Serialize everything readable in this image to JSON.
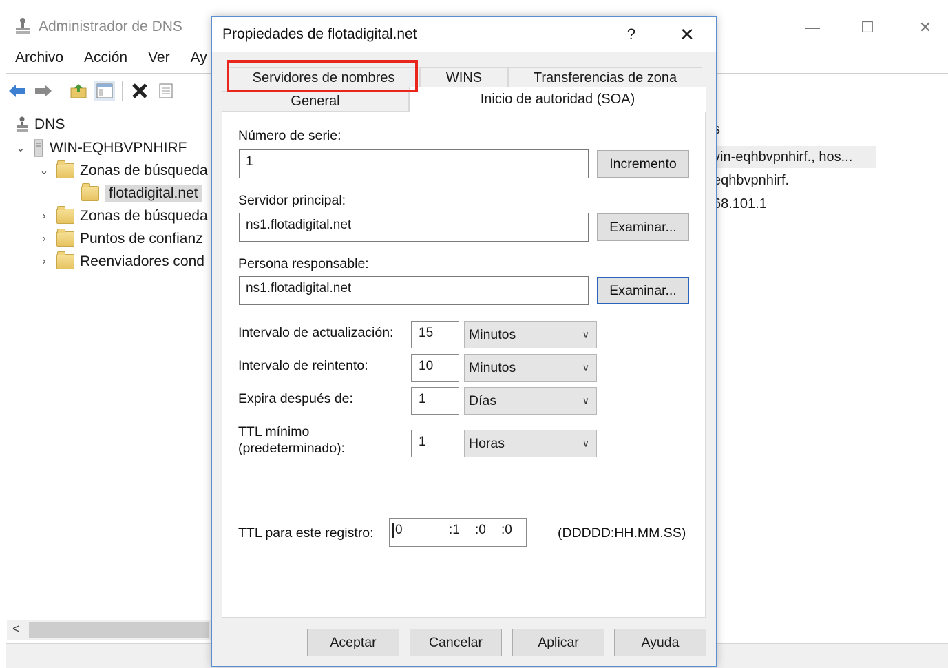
{
  "background_window": {
    "title": "Administrador de DNS",
    "menu": [
      "Archivo",
      "Acción",
      "Ver",
      "Ay"
    ],
    "controls": {
      "minimize": "—",
      "maximize": "☐",
      "close": "✕"
    },
    "tree": {
      "root": "DNS",
      "server": "WIN-EQHBVPNHIRF",
      "forward_zones": "Zonas de búsqueda",
      "zone": "flotadigital.net",
      "reverse_zones": "Zonas de búsqueda",
      "trust_points": "Puntos de confianz",
      "forwarders": "Reenviadores cond"
    },
    "right_pane": {
      "header": "s",
      "rows": [
        "vin-eqhbvpnhirf., hos...",
        "eqhbvpnhirf.",
        "68.101.1"
      ]
    },
    "scroll_left": "<"
  },
  "dialog": {
    "title": "Propiedades de flotadigital.net",
    "help": "?",
    "close": "✕",
    "tabs": {
      "name_servers": "Servidores de nombres",
      "wins": "WINS",
      "zone_transfers": "Transferencias de zona",
      "general": "General",
      "soa": "Inicio de autoridad (SOA)"
    },
    "highlight_color": "#e8261b",
    "serial": {
      "label": "Número de serie:",
      "value": "1",
      "button": "Incremento"
    },
    "primary_server": {
      "label": "Servidor principal:",
      "value": "ns1.flotadigital.net",
      "button": "Examinar..."
    },
    "responsible": {
      "label": "Persona responsable:",
      "value": "ns1.flotadigital.net",
      "button": "Examinar..."
    },
    "refresh": {
      "label": "Intervalo de actualización:",
      "value": "15",
      "unit": "Minutos"
    },
    "retry": {
      "label": "Intervalo de reintento:",
      "value": "10",
      "unit": "Minutos"
    },
    "expire": {
      "label": "Expira después de:",
      "value": "1",
      "unit": "Días"
    },
    "min_ttl": {
      "label_line1": "TTL mínimo",
      "label_line2": "(predeterminado):",
      "value": "1",
      "unit": "Horas"
    },
    "record_ttl": {
      "label": "TTL para este registro:",
      "days": "0",
      "hours": ":1",
      "minutes": ":0",
      "seconds": ":0",
      "format": "(DDDDD:HH.MM.SS)"
    },
    "buttons": {
      "ok": "Aceptar",
      "cancel": "Cancelar",
      "apply": "Aplicar",
      "help": "Ayuda"
    }
  }
}
